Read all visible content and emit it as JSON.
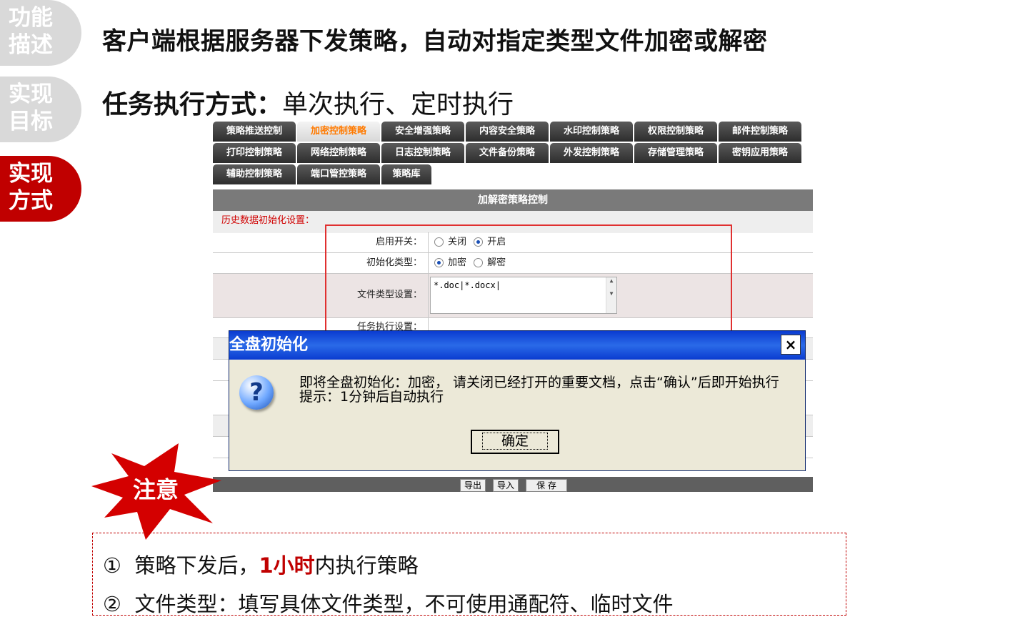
{
  "side_tabs": [
    {
      "label": "功能描述",
      "line1": "功能",
      "line2": "描述",
      "active": false
    },
    {
      "label": "实现目标",
      "line1": "实现",
      "line2": "目标",
      "active": false
    },
    {
      "label": "实现方式",
      "line1": "实现",
      "line2": "方式",
      "active": true
    }
  ],
  "headline": "客户端根据服务器下发策略，自动对指定类型文件加密或解密",
  "exec_mode": {
    "label": "任务执行方式：",
    "value": "单次执行、定时执行"
  },
  "screenshot": {
    "tab_rows": [
      [
        "策略推送控制",
        "加密控制策略",
        "安全增强策略",
        "内容安全策略",
        "水印控制策略",
        "权限控制策略",
        "邮件控制策略"
      ],
      [
        "打印控制策略",
        "网络控制策略",
        "日志控制策略",
        "文件备份策略",
        "外发控制策略",
        "存储管理策略",
        "密钥应用策略"
      ],
      [
        "辅助控制策略",
        "端口管控策略",
        "策略库"
      ]
    ],
    "active_tab": "加密控制策略",
    "panel_title": "加解密策略控制",
    "section_label": "历史数据初始化设置：",
    "rows": {
      "enable": {
        "label": "启用开关：",
        "off": "关闭",
        "on": "开启",
        "selected": "开启"
      },
      "init_type": {
        "label": "初始化类型：",
        "encrypt": "加密",
        "decrypt": "解密",
        "selected": "加密"
      },
      "file_types": {
        "label": "文件类型设置：",
        "value": "*.doc|*.docx|"
      },
      "task": {
        "label": "任务执行设置："
      }
    },
    "buttons": {
      "export": "导出",
      "import": "导入",
      "save": "保 存"
    }
  },
  "dialog": {
    "title": "全盘初始化",
    "close": "×",
    "message_line1": "即将全盘初始化：加密，  请关闭已经打开的重要文档，点击“确认”后即开始执行",
    "message_line2": "提示：1分钟后自动执行",
    "ok": "确定"
  },
  "note": {
    "badge": "注意",
    "items": [
      {
        "num": "①",
        "pre": "策略下发后，",
        "highlight": "1小时",
        "post": "内执行策略"
      },
      {
        "num": "②",
        "pre": "文件类型：填写具体文件类型，不可使用通配符、临时文件",
        "highlight": "",
        "post": ""
      }
    ]
  },
  "colors": {
    "accent": "#c00000",
    "tab_dark": "#3a3a3a",
    "tab_active_text": "#ff7a00",
    "dialog_title": "#0a3bd0"
  }
}
